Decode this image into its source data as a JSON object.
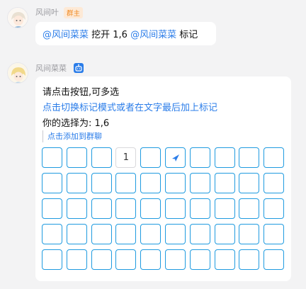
{
  "messages": [
    {
      "sender": "风间叶",
      "badge": "群主",
      "parts": [
        {
          "text": "@风间菜菜",
          "type": "mention"
        },
        {
          "text": " 挖开 1,6 ",
          "type": "text"
        },
        {
          "text": "@风间菜菜",
          "type": "mention"
        },
        {
          "text": " 标记",
          "type": "text"
        }
      ]
    },
    {
      "sender": "风间菜菜",
      "badge_icon": "robot-icon",
      "lines": [
        "请点击按钮,可多选",
        "点击切换标记模式或者在文字最后加上标记",
        "你的选择为: 1,6"
      ],
      "add_to_group": "点击添加到群聊"
    }
  ],
  "grid": {
    "rows": 5,
    "cols": 10,
    "cells": [
      {
        "row": 0,
        "col": 3,
        "label": "1"
      },
      {
        "row": 0,
        "col": 5,
        "icon": "flag-icon"
      }
    ]
  },
  "colors": {
    "accent": "#2b7de9",
    "cell_border": "#1f9be0",
    "owner_badge_text": "#f08a24",
    "owner_badge_bg": "#fde9d6",
    "background": "#f3f3f4"
  }
}
